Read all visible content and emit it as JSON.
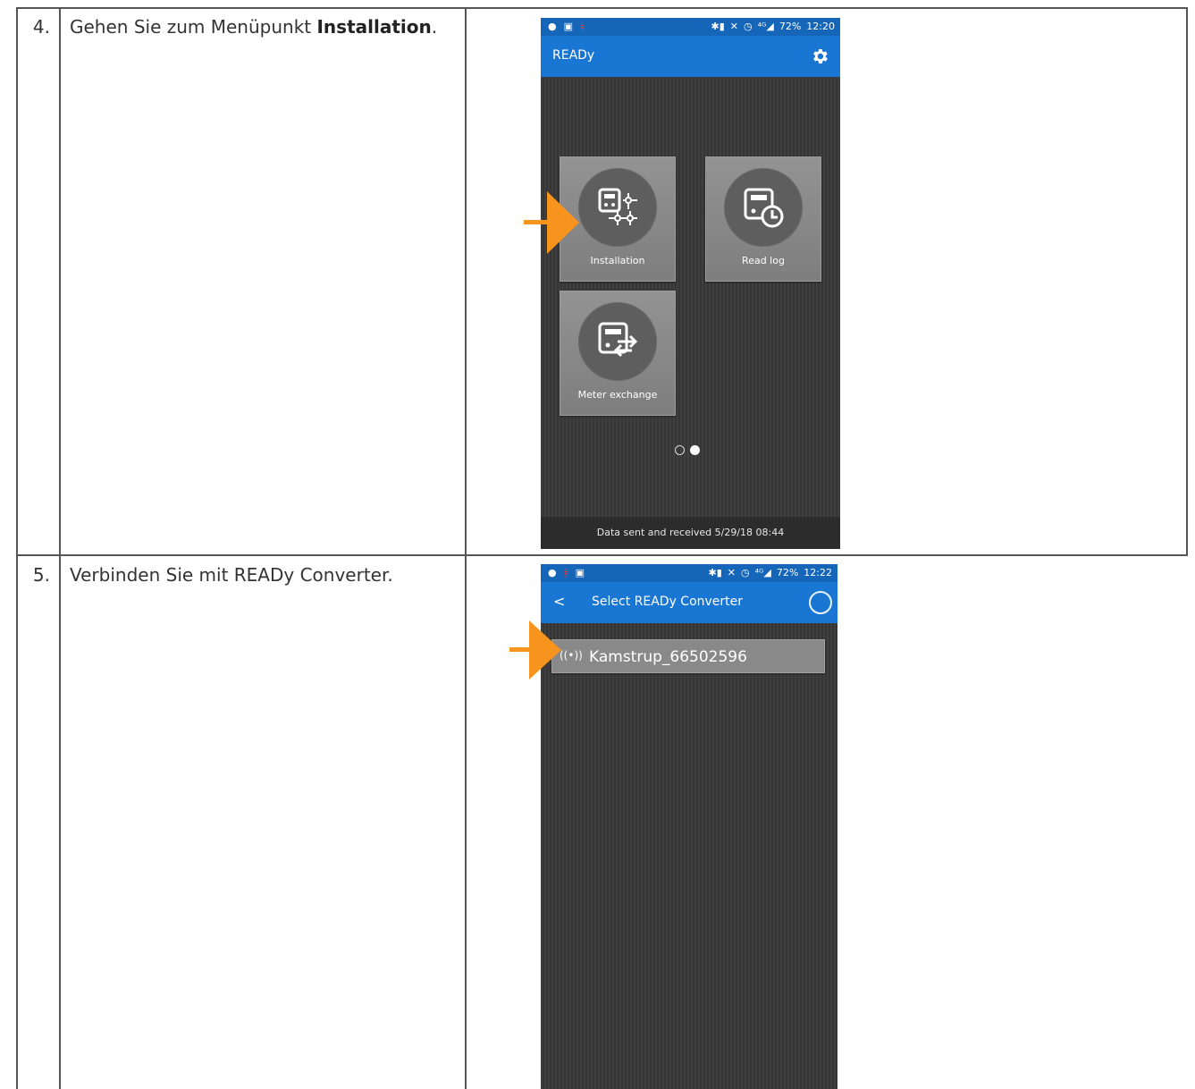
{
  "steps": [
    {
      "number": "4.",
      "text_before": "Gehen Sie zum Menüpunkt ",
      "text_bold": "Installation",
      "text_after": "."
    },
    {
      "number": "5.",
      "text": "Verbinden Sie mit READy Converter."
    }
  ],
  "screen1": {
    "status_right": [
      "✱▮",
      "✕",
      "◷",
      "⁴ᴳ◢",
      "72%",
      "12:20"
    ],
    "app_title": "READy",
    "tiles": [
      {
        "label": "Installation",
        "icon": "installation-icon"
      },
      {
        "label": "Read log",
        "icon": "read-log-icon"
      },
      {
        "label": "Meter exchange",
        "icon": "meter-exchange-icon"
      }
    ],
    "footer": "Data sent and received 5/29/18 08:44"
  },
  "screen2": {
    "status_right": [
      "✱▮",
      "✕",
      "◷",
      "⁴ᴳ◢",
      "72%",
      "12:22"
    ],
    "back": "<",
    "app_title": "Select READy Converter",
    "device": "Kamstrup_66502596",
    "device_icon": "((•))"
  },
  "colors": {
    "statusbar": "#1565b8",
    "appbar": "#1976d2",
    "arrow": "#f7941d",
    "screen_bg": "#3c3c3c"
  }
}
